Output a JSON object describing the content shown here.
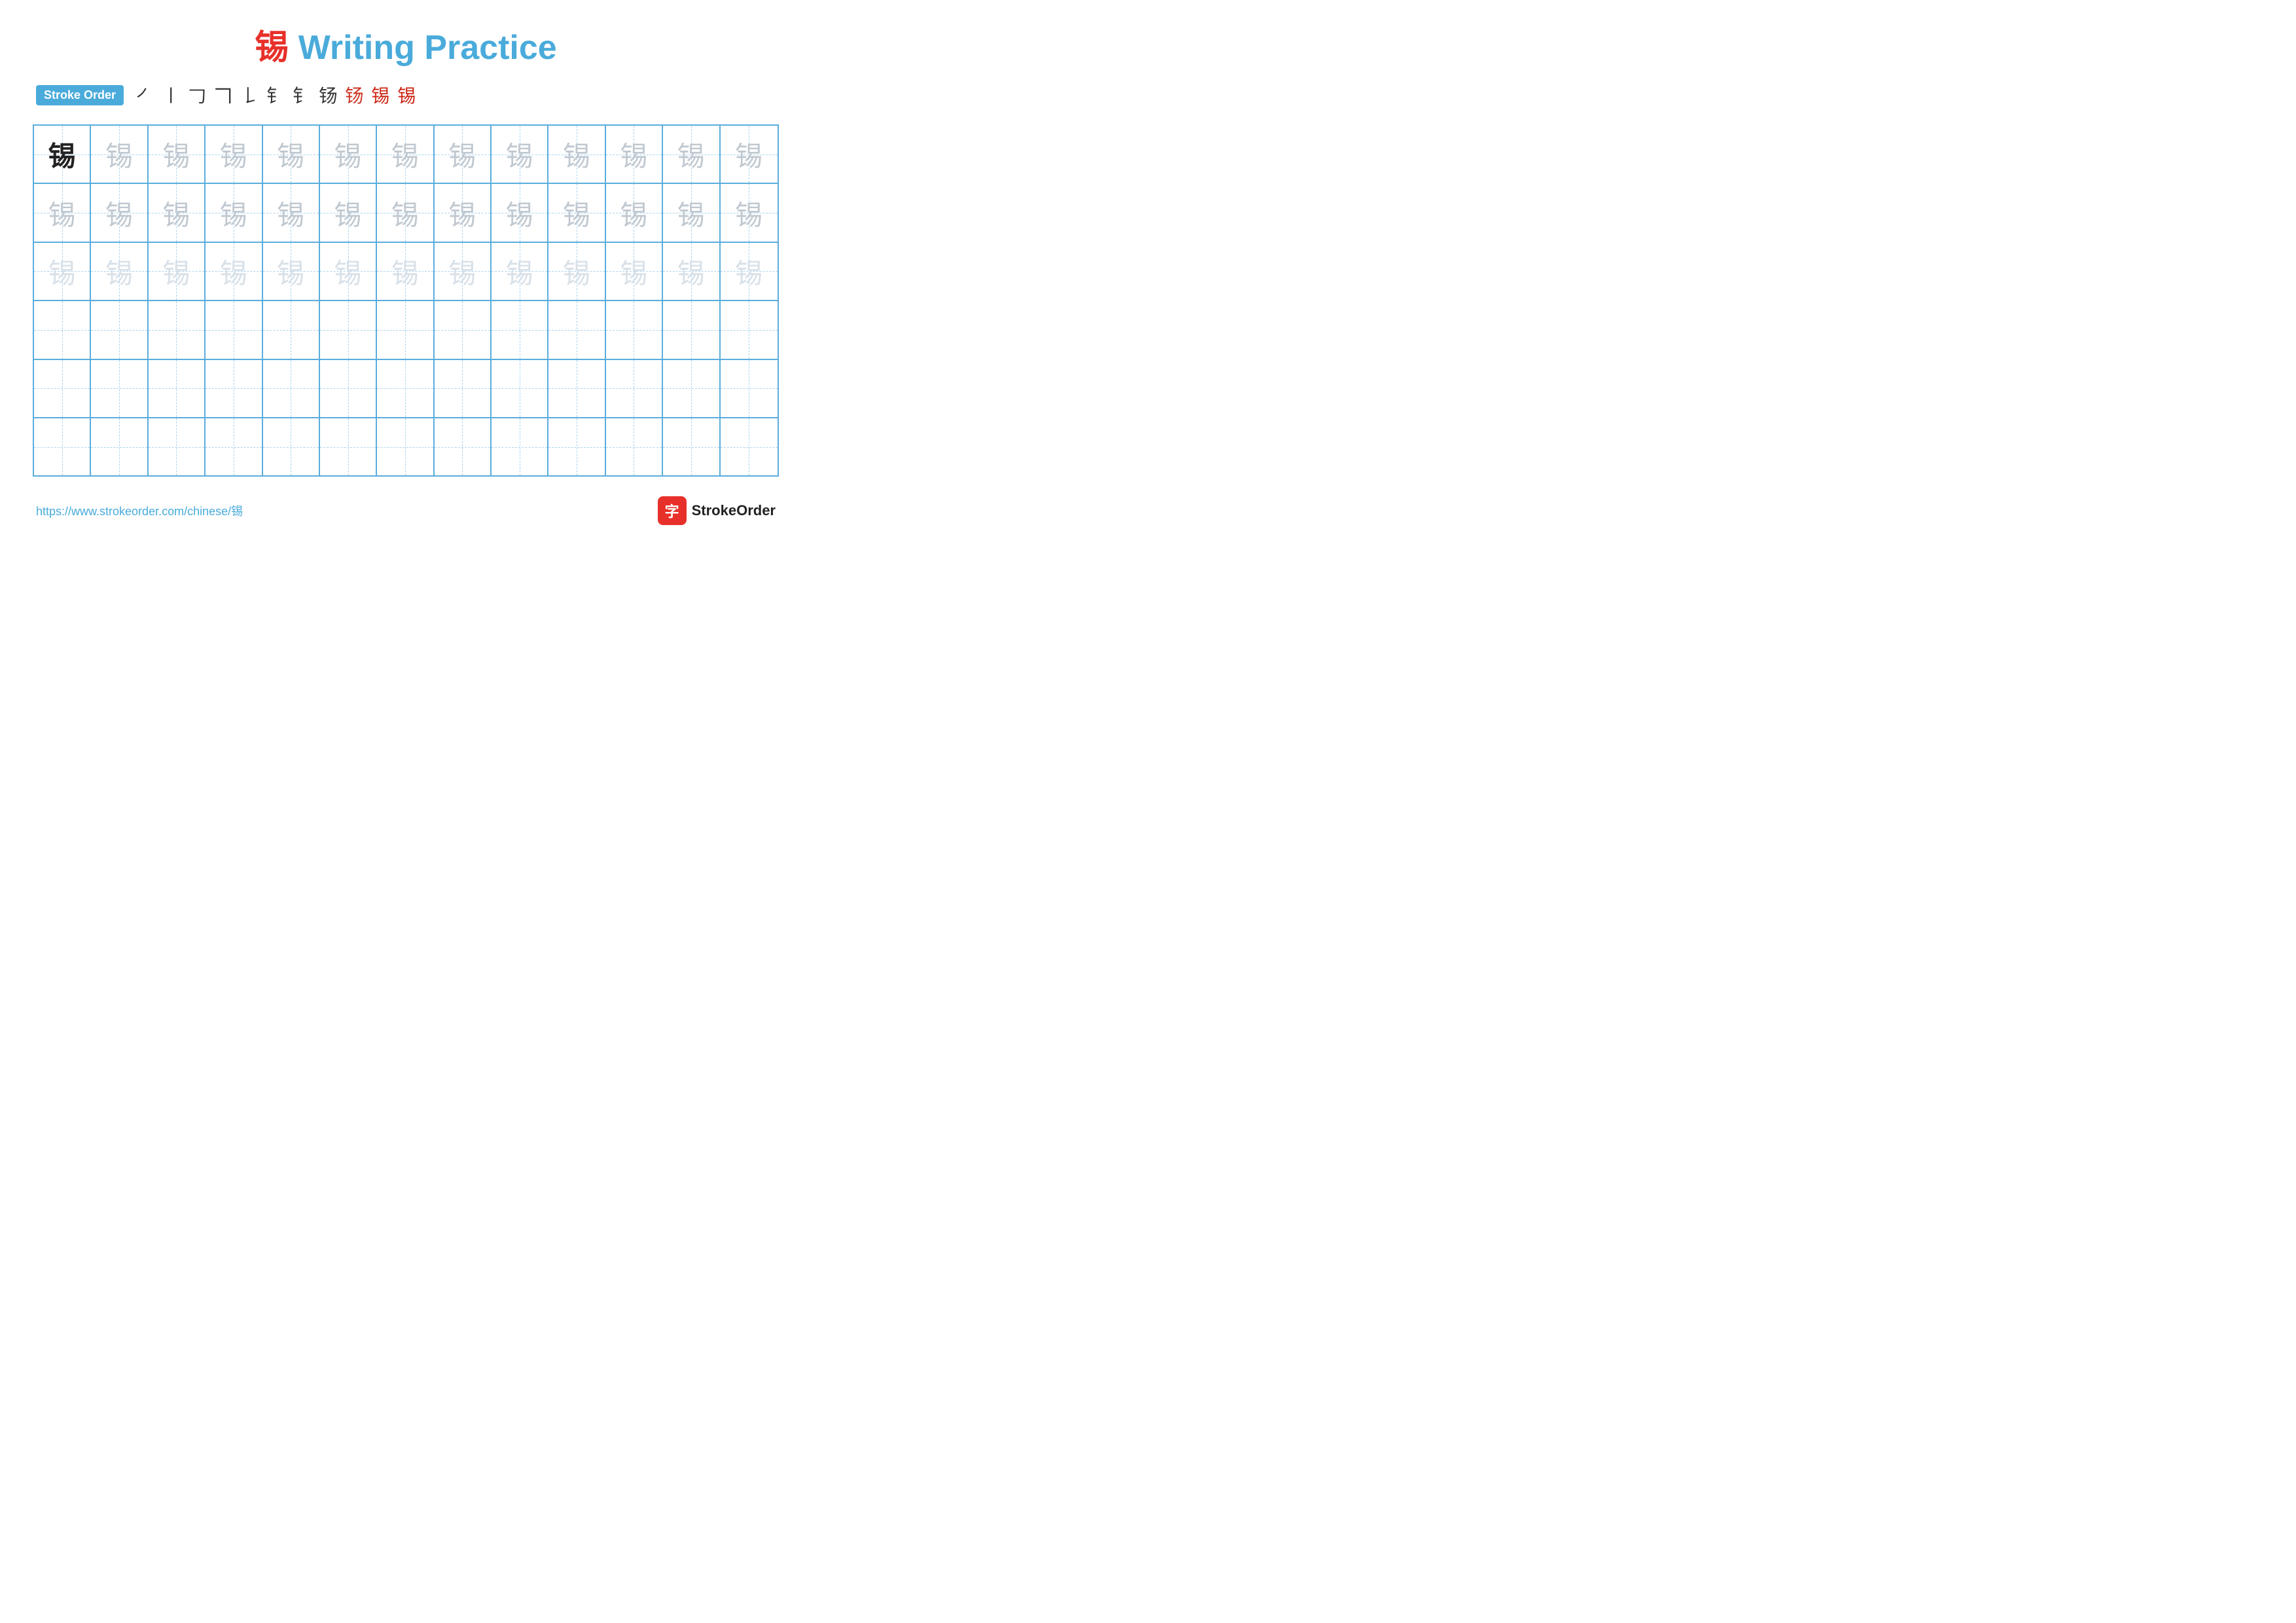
{
  "title": {
    "char": "锡",
    "text": " Writing Practice"
  },
  "stroke_order": {
    "badge_label": "Stroke Order",
    "strokes": [
      "丿",
      "𠂉",
      "𠃋",
      "㐃",
      "𠃊",
      "𠂇",
      "𢦏",
      "锡₇",
      "锡₈",
      "锡₉",
      "锡"
    ]
  },
  "character": "锡",
  "grid": {
    "rows": 6,
    "cols": 13,
    "row_configs": [
      {
        "type": "dark_first",
        "chars": [
          "dark",
          "medium",
          "medium",
          "medium",
          "medium",
          "medium",
          "medium",
          "medium",
          "medium",
          "medium",
          "medium",
          "medium",
          "medium"
        ]
      },
      {
        "type": "medium",
        "chars": [
          "medium",
          "medium",
          "medium",
          "medium",
          "medium",
          "medium",
          "medium",
          "medium",
          "medium",
          "medium",
          "medium",
          "medium",
          "medium"
        ]
      },
      {
        "type": "light",
        "chars": [
          "light",
          "light",
          "light",
          "light",
          "light",
          "light",
          "light",
          "light",
          "light",
          "light",
          "light",
          "light",
          "light"
        ]
      },
      {
        "type": "empty"
      },
      {
        "type": "empty"
      },
      {
        "type": "empty"
      }
    ]
  },
  "footer": {
    "url": "https://www.strokeorder.com/chinese/锡",
    "logo_char": "字",
    "logo_text": "StrokeOrder"
  }
}
